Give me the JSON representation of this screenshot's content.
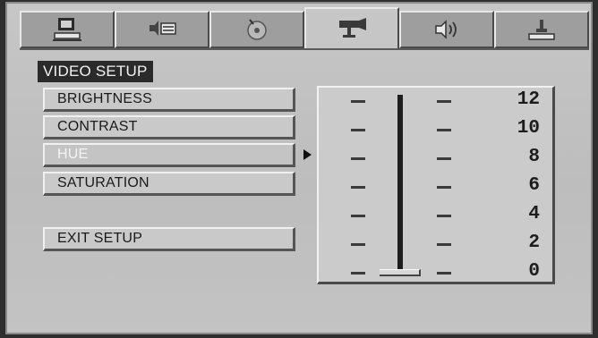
{
  "tabs": [
    {
      "name": "general",
      "icon": "monitor-icon",
      "active": false
    },
    {
      "name": "audio-video",
      "icon": "speaker-icon",
      "active": false
    },
    {
      "name": "dolby",
      "icon": "disc-icon",
      "active": false
    },
    {
      "name": "video",
      "icon": "camera-icon",
      "active": true
    },
    {
      "name": "speaker",
      "icon": "speaker-volume-icon",
      "active": false
    },
    {
      "name": "preference",
      "icon": "preference-icon",
      "active": false
    }
  ],
  "page": {
    "title": "VIDEO SETUP"
  },
  "menu": {
    "items": [
      {
        "label": "BRIGHTNESS",
        "selected": false
      },
      {
        "label": "CONTRAST",
        "selected": false
      },
      {
        "label": "HUE",
        "selected": true
      },
      {
        "label": "SATURATION",
        "selected": false
      }
    ],
    "exit_label": "EXIT SETUP"
  },
  "slider": {
    "labels": [
      "12",
      "10",
      "8",
      "6",
      "4",
      "2",
      "0"
    ],
    "value": 0,
    "min": 0,
    "max": 12
  },
  "colors": {
    "background": "#c6c6c6",
    "title_bg": "#2a2a2a",
    "selected_text": "#f4f4f4"
  }
}
